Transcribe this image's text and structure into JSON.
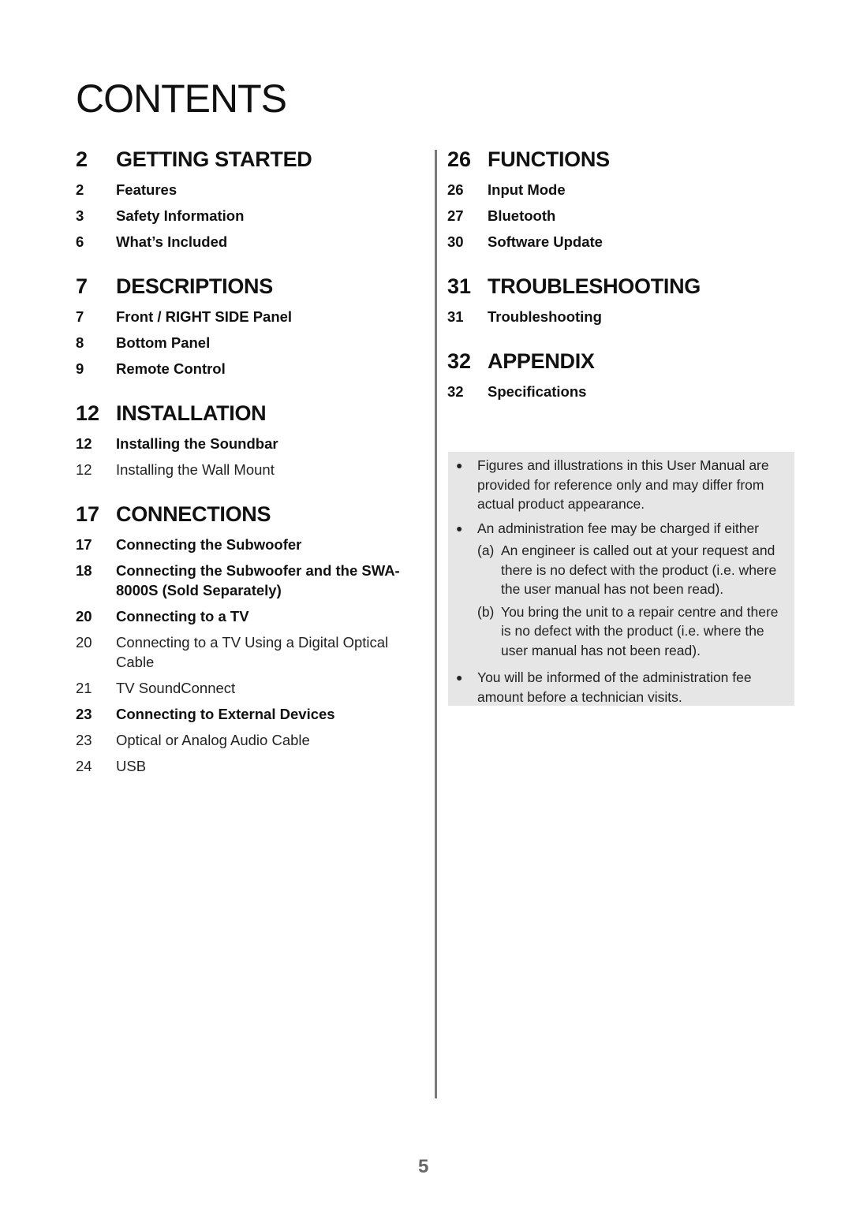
{
  "page": {
    "title": "CONTENTS",
    "page_number": "5"
  },
  "left_column": {
    "sections": [
      {
        "num": "2",
        "title": "GETTING STARTED",
        "entries": [
          {
            "num": "2",
            "label": "Features",
            "style": "bold"
          },
          {
            "num": "3",
            "label": "Safety Information",
            "style": "bold"
          },
          {
            "num": "6",
            "label": "What’s Included",
            "style": "bold"
          }
        ]
      },
      {
        "num": "7",
        "title": "DESCRIPTIONS",
        "entries": [
          {
            "num": "7",
            "label": "Front / RIGHT SIDE Panel",
            "style": "bold"
          },
          {
            "num": "8",
            "label": "Bottom Panel",
            "style": "bold"
          },
          {
            "num": "9",
            "label": "Remote Control",
            "style": "bold"
          }
        ]
      },
      {
        "num": "12",
        "title": "INSTALLATION",
        "entries": [
          {
            "num": "12",
            "label": "Installing the Soundbar",
            "style": "bold"
          },
          {
            "num": "12",
            "label": "Installing the Wall Mount",
            "style": "normal"
          }
        ]
      },
      {
        "num": "17",
        "title": "CONNECTIONS",
        "entries": [
          {
            "num": "17",
            "label": "Connecting the Subwoofer",
            "style": "bold"
          },
          {
            "num": "18",
            "label": "Connecting the Subwoofer and the SWA-8000S (Sold Separately)",
            "style": "bold"
          },
          {
            "num": "20",
            "label": "Connecting to a TV",
            "style": "bold"
          },
          {
            "num": "20",
            "label": "Connecting to a TV Using a Digital Optical Cable",
            "style": "normal"
          },
          {
            "num": "21",
            "label": "TV SoundConnect",
            "style": "normal"
          },
          {
            "num": "23",
            "label": "Connecting to External Devices",
            "style": "bold"
          },
          {
            "num": "23",
            "label": "Optical or Analog Audio Cable",
            "style": "normal"
          },
          {
            "num": "24",
            "label": "USB",
            "style": "normal"
          }
        ]
      }
    ]
  },
  "right_column": {
    "sections": [
      {
        "num": "26",
        "title": "FUNCTIONS",
        "entries": [
          {
            "num": "26",
            "label": "Input Mode",
            "style": "bold"
          },
          {
            "num": "27",
            "label": "Bluetooth",
            "style": "bold"
          },
          {
            "num": "30",
            "label": "Software Update",
            "style": "bold"
          }
        ]
      },
      {
        "num": "31",
        "title": "TROUBLESHOOTING",
        "entries": [
          {
            "num": "31",
            "label": "Troubleshooting",
            "style": "bold"
          }
        ]
      },
      {
        "num": "32",
        "title": "APPENDIX",
        "entries": [
          {
            "num": "32",
            "label": "Specifications",
            "style": "bold"
          }
        ]
      }
    ]
  },
  "notice": {
    "bullet_icon": "filled-circle",
    "bullets": [
      {
        "text": "Figures and illustrations in this User Manual are provided for reference only and may differ from actual product appearance."
      },
      {
        "text": "An administration fee may be charged if either",
        "subitems": [
          {
            "marker": "(a)",
            "text": "An engineer is called out at your request and there is no defect with the product (i.e. where the user manual has not been read)."
          },
          {
            "marker": "(b)",
            "text": "You bring the unit to a repair centre and there is no defect with the product (i.e. where the user manual has not been read)."
          }
        ]
      },
      {
        "text": "You will be informed of the administration fee amount before a technician visits."
      }
    ]
  }
}
